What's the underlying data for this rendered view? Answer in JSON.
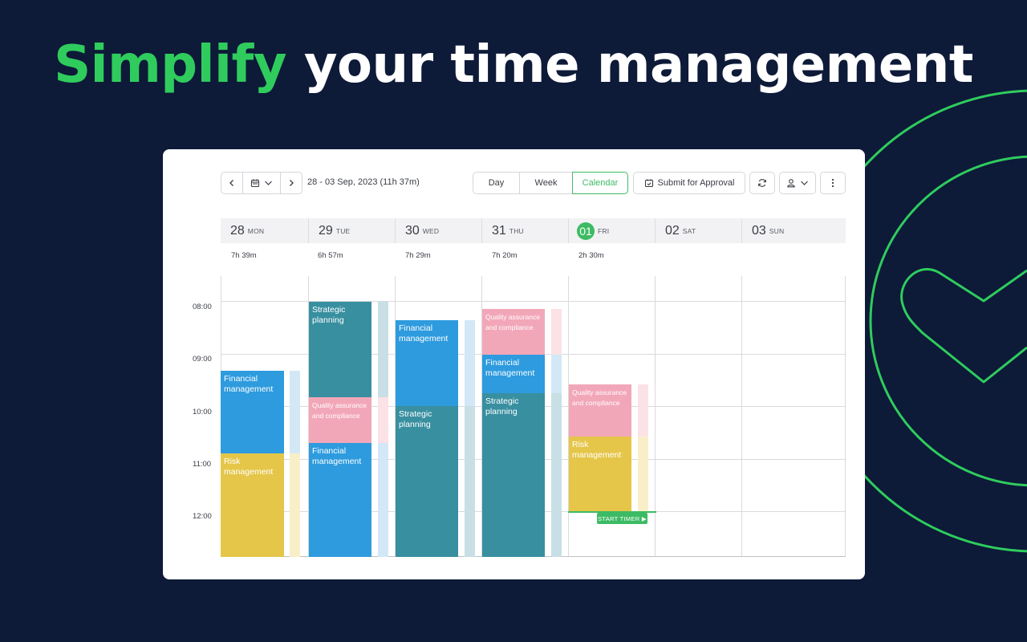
{
  "headline": {
    "accent": "Simplify",
    "rest": " your time management"
  },
  "colors": {
    "background": "#0d1a38",
    "accent": "#2fcc5d",
    "financial": "#2e9bde",
    "strategic": "#388fa0",
    "quality": "#f2a7b8",
    "risk": "#e5c649"
  },
  "toolbar": {
    "date_range": "28 - 03 Sep, 2023 (11h 37m)",
    "views": [
      "Day",
      "Week",
      "Calendar"
    ],
    "active_view": "Calendar",
    "submit_label": "Submit for Approval",
    "icons": [
      "chevron-left-icon",
      "calendar-icon",
      "chevron-down-icon",
      "chevron-right-icon",
      "submit-calendar-icon",
      "refresh-icon",
      "user-icon",
      "more-vertical-icon"
    ]
  },
  "days": [
    {
      "num": "28",
      "name": "MON",
      "total": "7h 39m"
    },
    {
      "num": "29",
      "name": "TUE",
      "total": "6h 57m"
    },
    {
      "num": "30",
      "name": "WED",
      "total": "7h 29m"
    },
    {
      "num": "31",
      "name": "THU",
      "total": "7h 20m"
    },
    {
      "num": "01",
      "name": "FRI",
      "total": "2h 30m",
      "today": true
    },
    {
      "num": "02",
      "name": "SAT",
      "total": ""
    },
    {
      "num": "03",
      "name": "SUN",
      "total": ""
    }
  ],
  "times": [
    "08:00",
    "09:00",
    "10:00",
    "11:00",
    "12:00"
  ],
  "events": {
    "mon_financial": "Financial management",
    "mon_risk": "Risk management",
    "tue_strategic": "Strategic planning",
    "tue_quality": "Quality assurance and compliance",
    "tue_financial": "Financial management",
    "wed_financial": "Financial management",
    "wed_strategic": "Strategic planning",
    "thu_quality": "Quality assurance and compliance",
    "thu_financial": "Financial management",
    "thu_strategic": "Strategic planning",
    "fri_quality": "Quality assurance and compliance",
    "fri_risk": "Risk management"
  },
  "start_timer_label": "START TIMER ▶"
}
